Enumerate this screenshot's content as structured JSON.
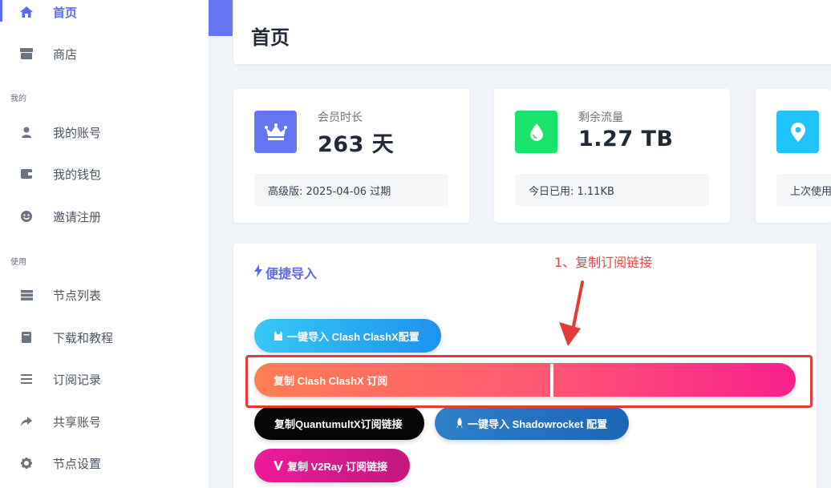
{
  "sidebar": {
    "items": [
      {
        "label": "首页",
        "icon": "home-icon",
        "active": true
      },
      {
        "label": "商店",
        "icon": "store-icon"
      },
      {
        "label": "我的账号",
        "icon": "user-icon"
      },
      {
        "label": "我的钱包",
        "icon": "wallet-icon"
      },
      {
        "label": "邀请注册",
        "icon": "smile-icon"
      },
      {
        "label": "节点列表",
        "icon": "server-icon"
      },
      {
        "label": "下载和教程",
        "icon": "book-icon"
      },
      {
        "label": "订阅记录",
        "icon": "list-icon"
      },
      {
        "label": "共享账号",
        "icon": "share-icon"
      },
      {
        "label": "节点设置",
        "icon": "gear-icon"
      }
    ],
    "sections": {
      "mine": "我的",
      "use": "使用"
    }
  },
  "header": {
    "title": "首页"
  },
  "stats": [
    {
      "label": "会员时长",
      "value": "263 天",
      "foot": "高级版: 2025-04-06 过期",
      "icon": "crown-icon",
      "color": "#6675f4"
    },
    {
      "label": "剩余流量",
      "value": "1.27 TB",
      "foot": "今日已用: 1.11KB",
      "icon": "drop-icon",
      "color": "#19e36a"
    },
    {
      "label": "",
      "value": "",
      "foot": "上次使用",
      "icon": "location-pin-icon",
      "color": "#1ec3f8"
    }
  ],
  "import": {
    "title": "便捷导入",
    "annotation": "1、复制订阅链接",
    "buttons": {
      "clash_import": "一键导入 Clash ClashX配置",
      "clash_copy": "复制 Clash ClashX 订阅",
      "quantumult": "复制QuantumultX订阅链接",
      "shadowrocket": "一键导入 Shadowrocket 配置",
      "v2ray": "复制 V2Ray 订阅链接"
    }
  },
  "colors": {
    "accent": "#5b6cf0",
    "annotation": "#e53935"
  }
}
